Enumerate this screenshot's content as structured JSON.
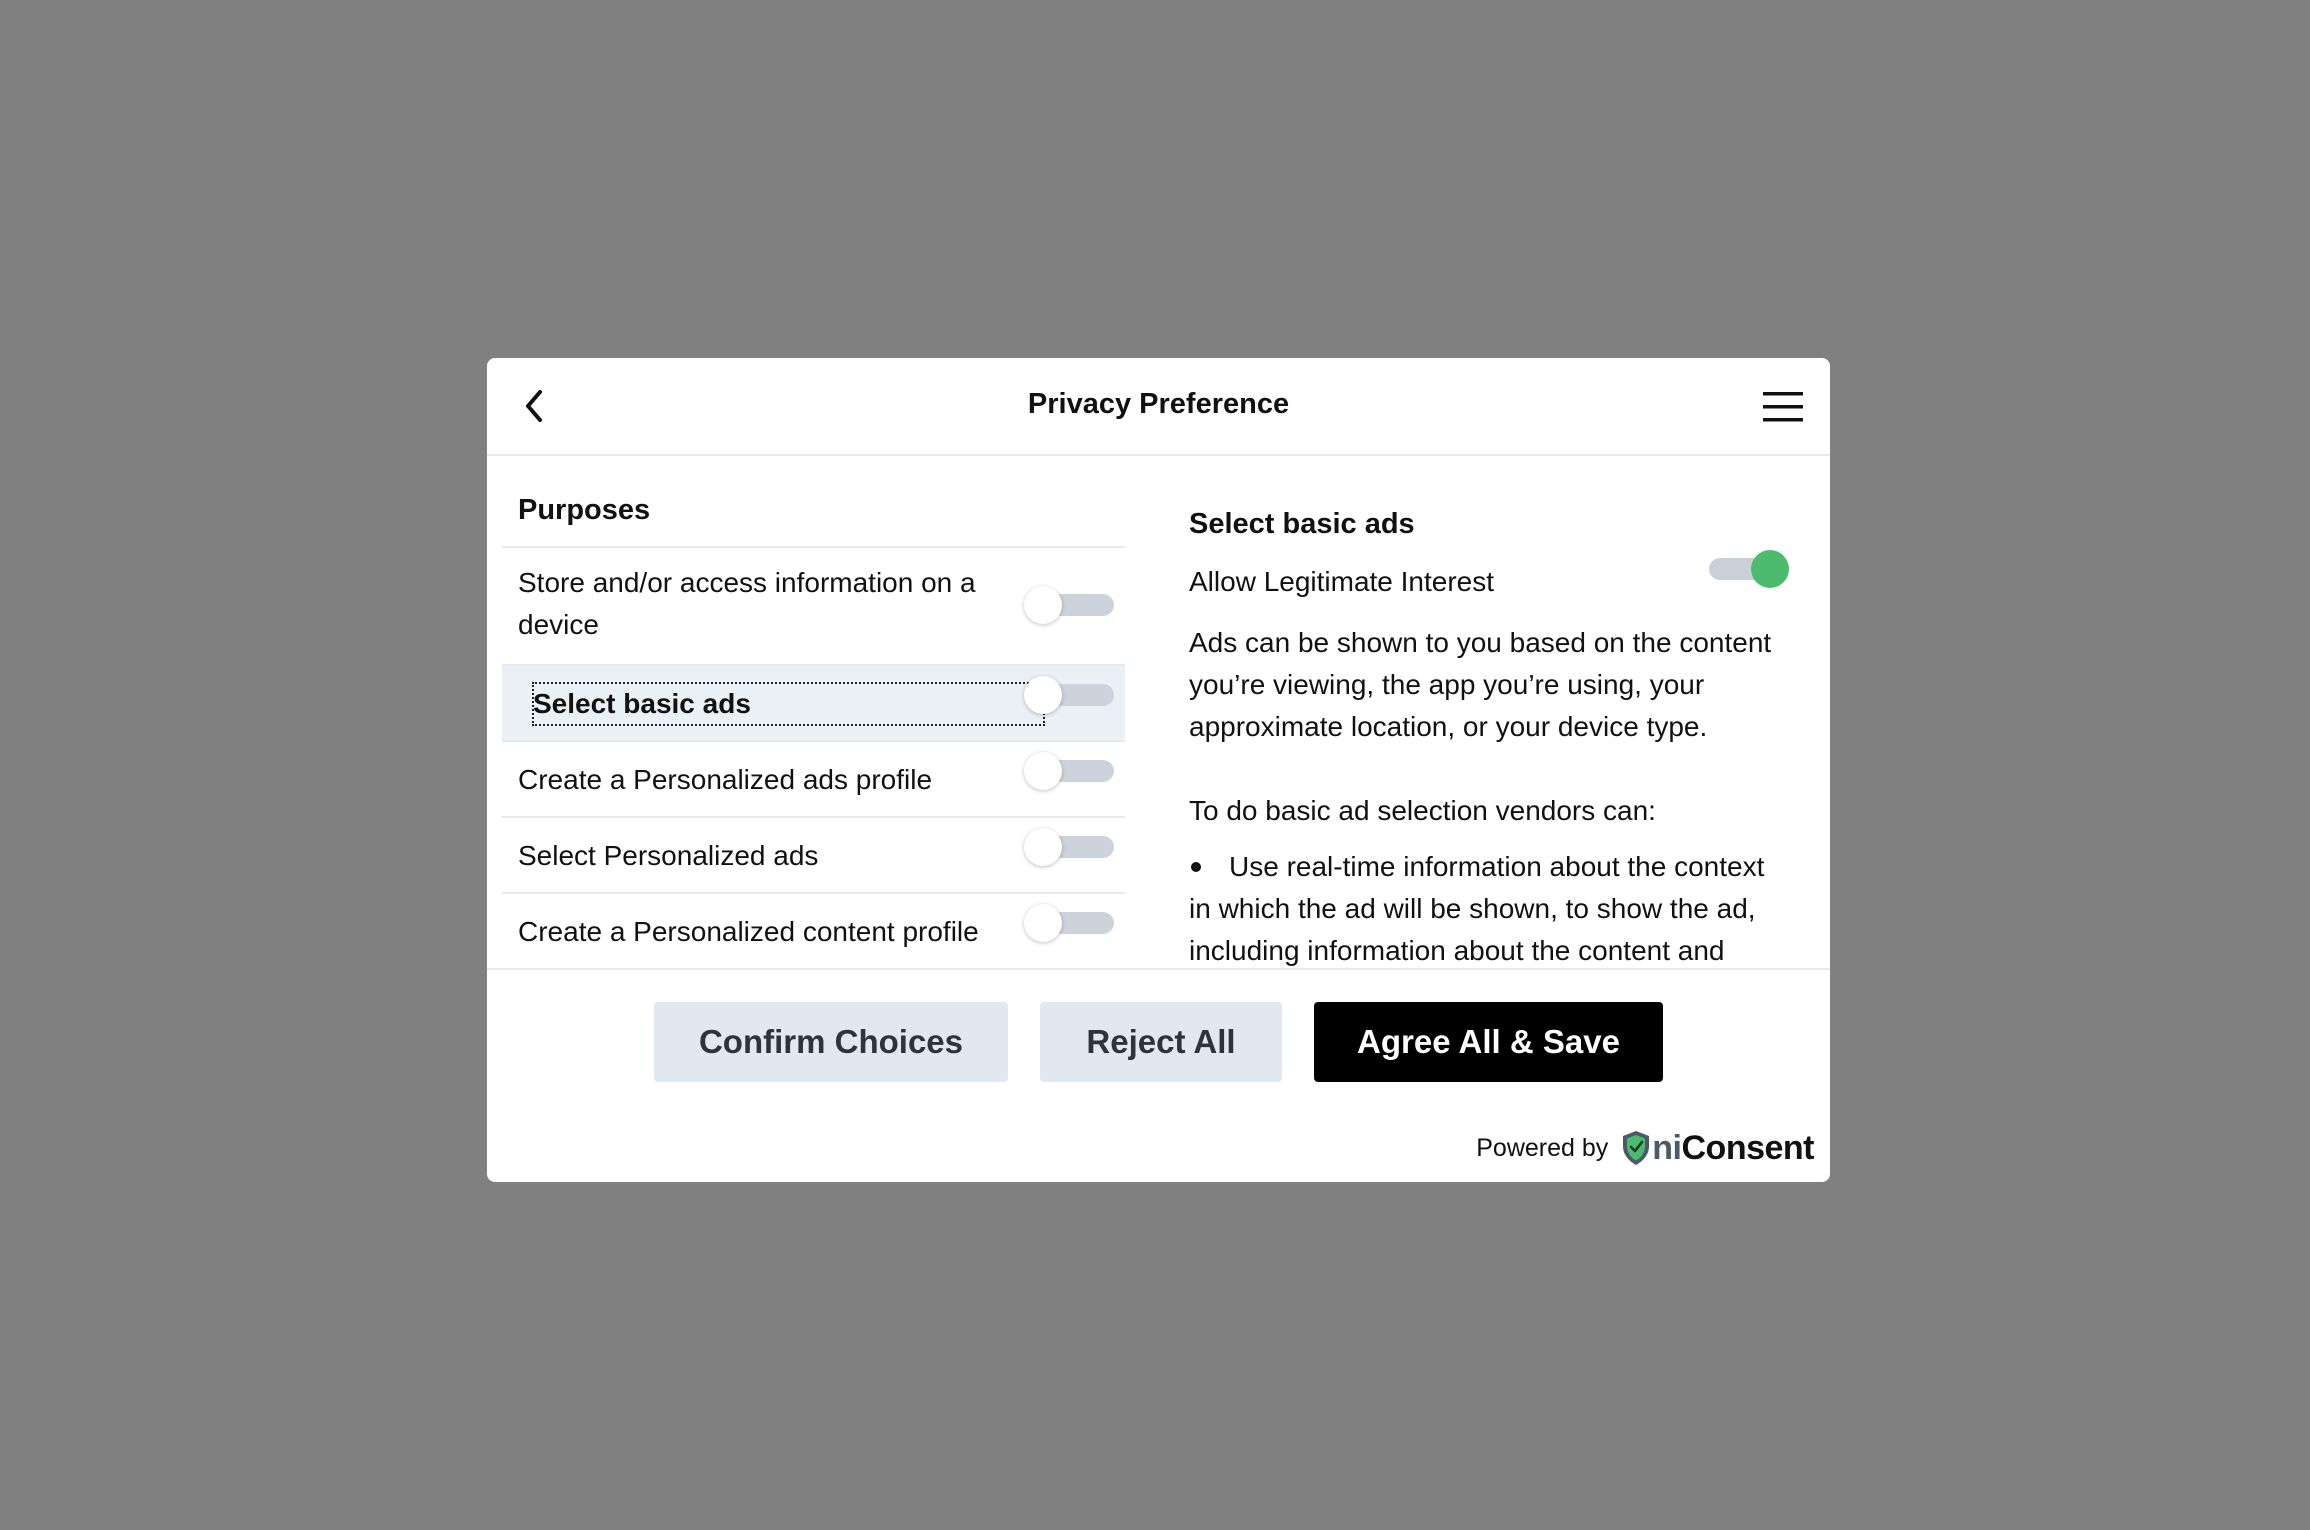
{
  "header": {
    "title": "Privacy Preference",
    "back_icon": "chevron-left-icon",
    "menu_icon": "hamburger-menu-icon"
  },
  "purposes": {
    "heading": "Purposes",
    "items": [
      {
        "label": "Store and/or access information on a device",
        "enabled": false,
        "selected": false
      },
      {
        "label": "Select basic ads",
        "enabled": false,
        "selected": true
      },
      {
        "label": "Create a Personalized ads profile",
        "enabled": false,
        "selected": false
      },
      {
        "label": "Select Personalized ads",
        "enabled": false,
        "selected": false
      },
      {
        "label": "Create a Personalized content profile",
        "enabled": false,
        "selected": false
      }
    ]
  },
  "detail": {
    "title": "Select basic ads",
    "legitimate_interest_label": "Allow Legitimate Interest",
    "legitimate_interest_enabled": true,
    "description": "Ads can be shown to you based on the content you’re viewing, the app you’re using, your approximate location, or your device type.",
    "subheading": "To do basic ad selection vendors can:",
    "bullet": "Use real-time information about the context in which the ad will be shown, to show the ad, including information about the content and"
  },
  "buttons": {
    "confirm": "Confirm Choices",
    "reject": "Reject All",
    "agree": "Agree All & Save"
  },
  "footer": {
    "powered_by": "Powered by",
    "brand_prefix": "ni",
    "brand_suffix": "Consent"
  },
  "colors": {
    "toggle_on": "#4cbb6e",
    "toggle_off_track": "#cdd3da",
    "selected_row_bg": "#ebf0f5",
    "secondary_button_bg": "#e2e8f0",
    "primary_button_bg": "#000000",
    "backdrop": "#808080",
    "shield_green": "#4cbb6e"
  }
}
